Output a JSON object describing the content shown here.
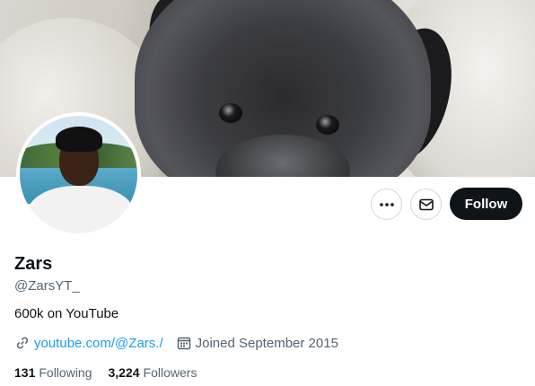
{
  "profile": {
    "display_name": "Zars",
    "handle": "@ZarsYT_",
    "bio": "600k on YouTube",
    "website": "youtube.com/@Zars./",
    "joined": "Joined September 2015"
  },
  "stats": {
    "following_count": "131",
    "following_label": "Following",
    "followers_count": "3,224",
    "followers_label": "Followers"
  },
  "actions": {
    "follow_label": "Follow"
  },
  "icons": {
    "more": "more-options-icon",
    "mail": "mail-icon",
    "link": "link-icon",
    "calendar": "calendar-icon"
  },
  "colors": {
    "link": "#1d9bf0",
    "secondary_text": "#536471",
    "primary_text": "#0f1419",
    "follow_bg": "#0f1419"
  }
}
